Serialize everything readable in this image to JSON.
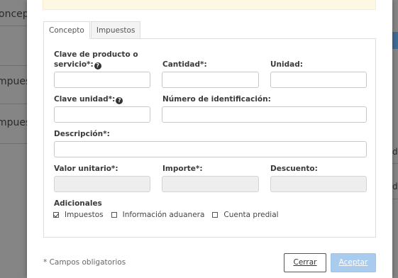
{
  "background": {
    "labels": [
      "oncept",
      "mpuest",
      "mpuest",
      "da",
      "de"
    ]
  },
  "tabs": [
    {
      "label": "Concepto",
      "active": true
    },
    {
      "label": "Impuestos",
      "active": false
    }
  ],
  "fields": {
    "clave_producto": {
      "label_line1": "Clave de producto o",
      "label_line2": "servicio*:",
      "value": ""
    },
    "cantidad": {
      "label": "Cantidad*:",
      "value": ""
    },
    "unidad": {
      "label": "Unidad:",
      "value": ""
    },
    "clave_unidad": {
      "label": "Clave unidad*:",
      "value": ""
    },
    "numero_identificacion": {
      "label": "Número de identificación:",
      "value": ""
    },
    "descripcion": {
      "label": "Descripción*:",
      "value": ""
    },
    "valor_unitario": {
      "label": "Valor unitario*:",
      "value": ""
    },
    "importe": {
      "label": "Importe*:",
      "value": ""
    },
    "descuento": {
      "label": "Descuento:",
      "value": ""
    }
  },
  "adicionales": {
    "title": "Adicionales",
    "options": [
      {
        "label": "Impuestos",
        "checked": true
      },
      {
        "label": "Información aduanera",
        "checked": false
      },
      {
        "label": "Cuenta predial",
        "checked": false
      }
    ]
  },
  "footer": {
    "note": "* Campos obligatorios",
    "close_label": "Cerrar",
    "accept_label": "Aceptar"
  },
  "icons": {
    "help": "question-circle-icon",
    "checkbox": "checkbox-icon"
  },
  "colors": {
    "accept_button": "#a8cbee",
    "alert_strip": "#fcf8e3",
    "overlay": "#858585"
  }
}
